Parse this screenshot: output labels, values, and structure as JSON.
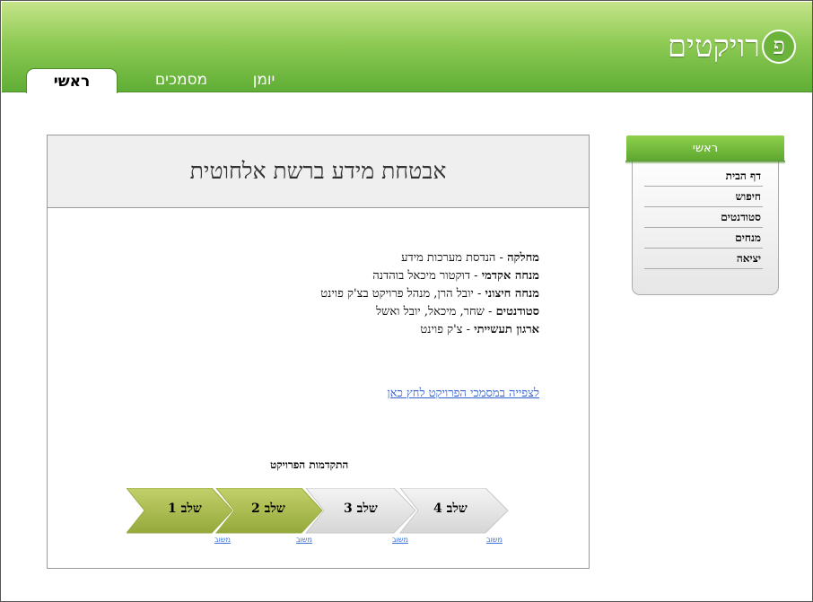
{
  "header": {
    "logo_badge": "פ",
    "logo_text": "רויקטים",
    "tabs": [
      {
        "label": "ראשי",
        "active": true
      },
      {
        "label": "מסמכים",
        "active": false
      },
      {
        "label": "יומן",
        "active": false
      }
    ]
  },
  "sidebar": {
    "title": "ראשי",
    "items": [
      {
        "label": "דף הבית"
      },
      {
        "label": "חיפוש"
      },
      {
        "label": "סטודנטים"
      },
      {
        "label": "מנחים"
      },
      {
        "label": "יציאה"
      }
    ]
  },
  "main": {
    "title": "אבטחת מידע ברשת אלחוטית",
    "info": [
      {
        "label": "מחלקה",
        "value": "הנדסת מערכות מידע"
      },
      {
        "label": "מנחה אקדמי",
        "value": "דוקטור מיכאל בוהדנה"
      },
      {
        "label": "מנחה חיצוני",
        "value": "יובל הרן, מנהל פרויקט בצ'ק פוינט"
      },
      {
        "label": "סטודנטים",
        "value": "שחר, מיכאל, יובל ואשל"
      },
      {
        "label": "ארגון תעשייתי",
        "value": "צ'ק פוינט"
      }
    ],
    "separator": " - ",
    "docs_link": "לצפייה במסמכי הפרויקט לחץ כאן",
    "progress_title": "התקדמות הפרויקט",
    "stages": [
      {
        "label": "שלב 1",
        "status": "משוב",
        "completed": true
      },
      {
        "label": "שלב 2",
        "status": "משוב",
        "completed": true
      },
      {
        "label": "שלב 3",
        "status": "משוב",
        "completed": false
      },
      {
        "label": "שלב 4",
        "status": "משוב",
        "completed": false
      }
    ]
  },
  "colors": {
    "header_green": "#6cb33c",
    "stage_done": "#a7b94a",
    "stage_pending": "#e2e2e2",
    "link_blue": "#2f5fd0"
  }
}
